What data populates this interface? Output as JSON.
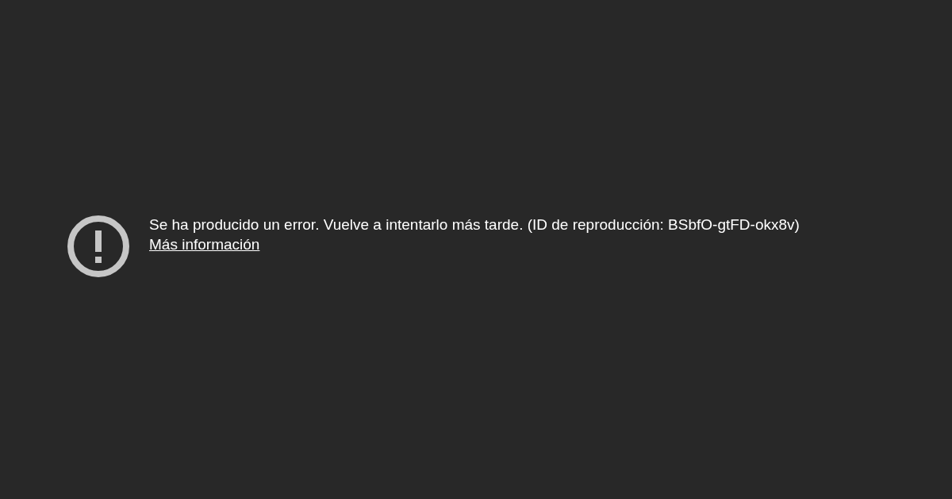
{
  "error": {
    "message": "Se ha producido un error. Vuelve a intentarlo más tarde. (ID de reproducción: BSbfO-gtFD-okx8v)",
    "link": "Más información"
  }
}
